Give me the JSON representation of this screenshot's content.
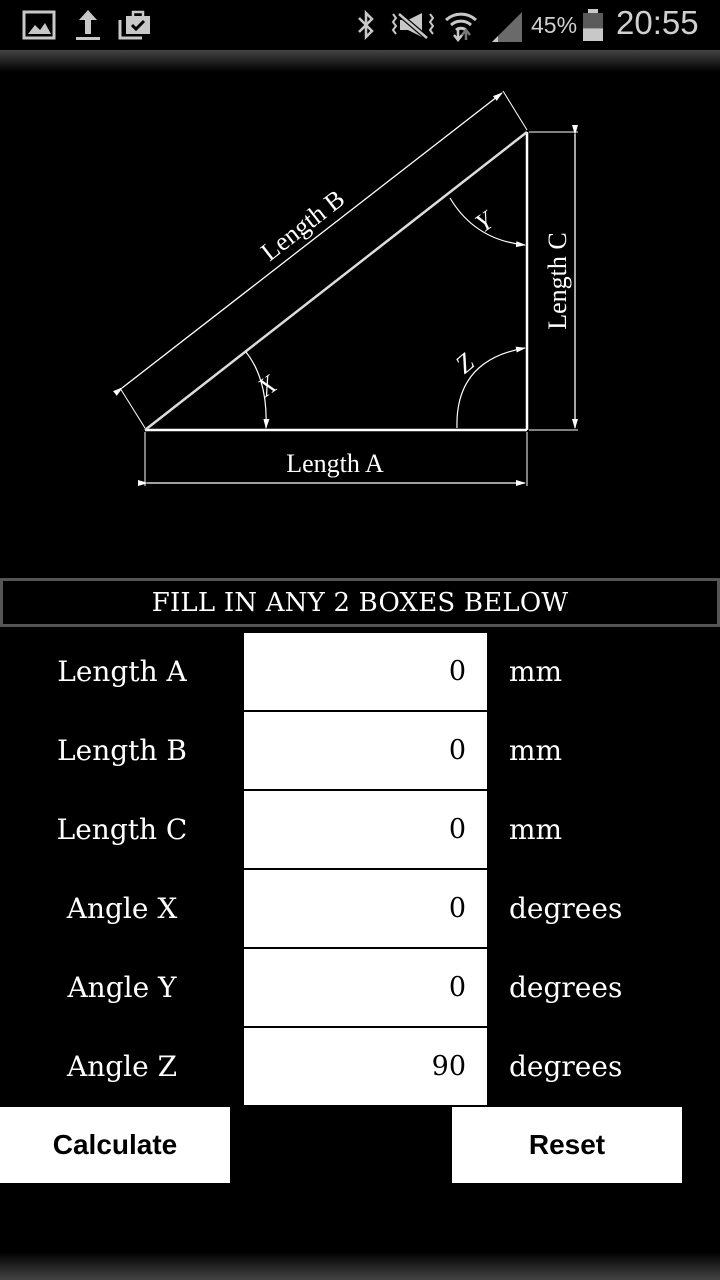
{
  "status_bar": {
    "left_icons": [
      "gallery-icon",
      "upload-icon",
      "shopping-bag-check-icon"
    ],
    "right_icons": [
      "bluetooth-icon",
      "mute-vibrate-icon",
      "wifi-icon",
      "signal-icon",
      "battery-icon"
    ],
    "battery_percent": "45%",
    "battery_level": 0.45,
    "time": "20:55"
  },
  "diagram": {
    "labels": {
      "length_a": "Length A",
      "length_b": "Length B",
      "length_c": "Length C",
      "angle_x": "X",
      "angle_y": "Y",
      "angle_z": "Z"
    }
  },
  "form": {
    "instruction": "FILL IN ANY 2 BOXES BELOW",
    "fields": [
      {
        "label": "Length A",
        "value": "0",
        "unit": "mm"
      },
      {
        "label": "Length B",
        "value": "0",
        "unit": "mm"
      },
      {
        "label": "Length C",
        "value": "0",
        "unit": "mm"
      },
      {
        "label": "Angle X",
        "value": "0",
        "unit": "degrees"
      },
      {
        "label": "Angle Y",
        "value": "0",
        "unit": "degrees"
      },
      {
        "label": "Angle Z",
        "value": "90",
        "unit": "degrees"
      }
    ]
  },
  "buttons": {
    "calculate": "Calculate",
    "reset": "Reset"
  }
}
